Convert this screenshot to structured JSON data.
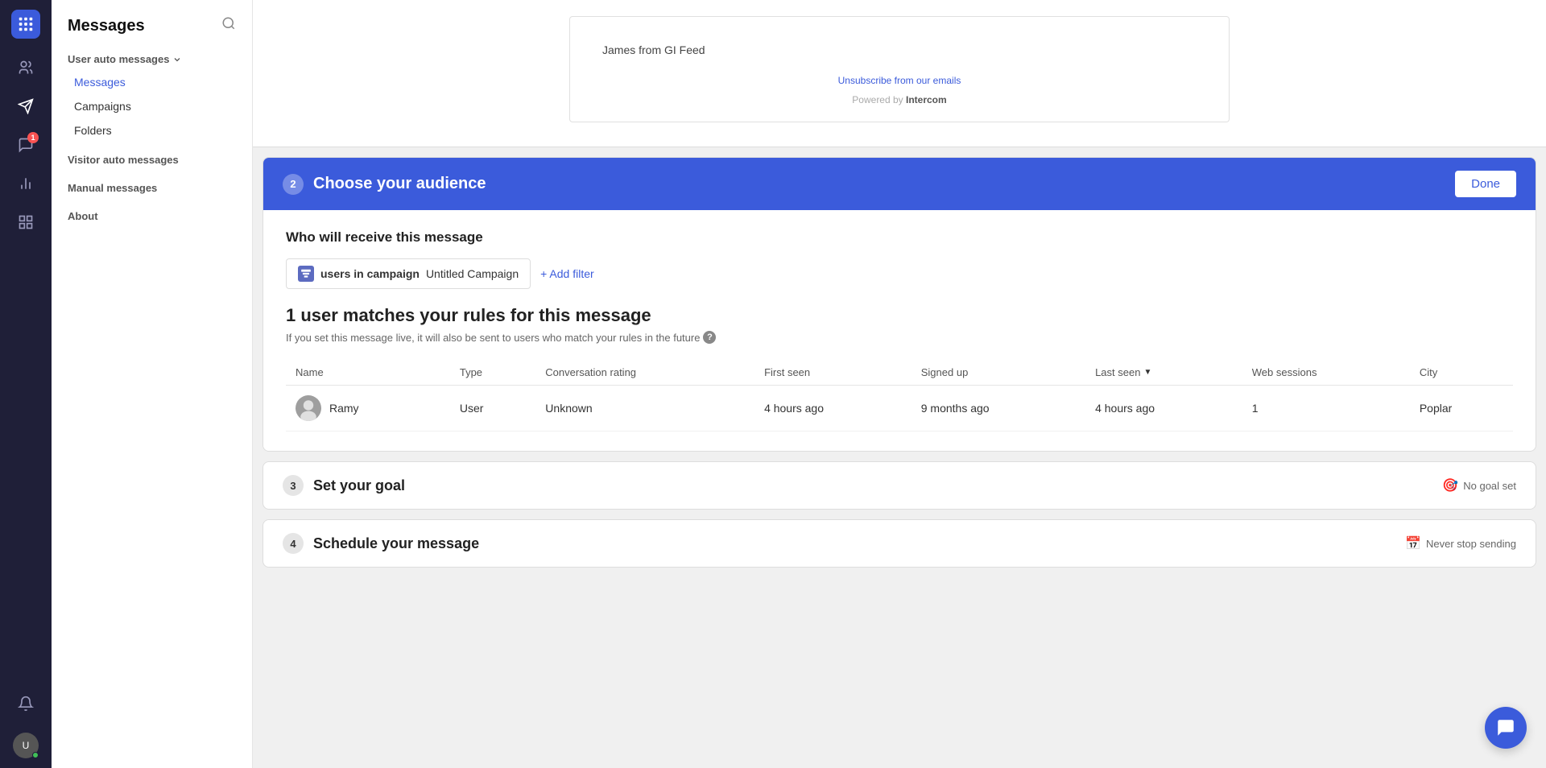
{
  "app": {
    "logo_alt": "Intercom"
  },
  "sidebar": {
    "icons": [
      {
        "name": "inbox-icon",
        "unicode": "💬",
        "active": false,
        "badge": null
      },
      {
        "name": "contacts-icon",
        "unicode": "👥",
        "active": false,
        "badge": null
      },
      {
        "name": "outbound-icon",
        "unicode": "✈",
        "active": true,
        "badge": null
      },
      {
        "name": "chat-icon",
        "unicode": "🗨",
        "active": false,
        "badge": "1"
      },
      {
        "name": "reports-icon",
        "unicode": "📊",
        "active": false,
        "badge": null
      },
      {
        "name": "apps-icon",
        "unicode": "⊞",
        "active": false,
        "badge": null
      },
      {
        "name": "notifications-icon",
        "unicode": "🔔",
        "active": false,
        "badge": null
      }
    ],
    "user_initials": "U",
    "online": true
  },
  "nav": {
    "title": "Messages",
    "sections": [
      {
        "label": "User auto messages",
        "dropdown": true,
        "items": [
          {
            "label": "Messages",
            "active": true
          },
          {
            "label": "Campaigns",
            "active": false
          },
          {
            "label": "Folders",
            "active": false
          }
        ]
      },
      {
        "label": "Visitor auto messages",
        "dropdown": false,
        "items": []
      },
      {
        "label": "Manual messages",
        "dropdown": false,
        "items": []
      },
      {
        "label": "About",
        "dropdown": false,
        "items": []
      }
    ]
  },
  "email_preview": {
    "sender": "James from GI Feed",
    "unsubscribe_text": "Unsubscribe from our emails",
    "powered_by_prefix": "Powered by ",
    "powered_by_brand": "Intercom"
  },
  "choose_audience": {
    "step_number": "2",
    "title": "Choose your audience",
    "done_label": "Done",
    "who_receives": "Who will receive this message",
    "filter": {
      "icon_label": "layers",
      "filter_bold": "users in campaign",
      "filter_value": "Untitled Campaign"
    },
    "add_filter_label": "+ Add filter",
    "match_headline": "1 user matches your rules for this message",
    "match_subtext": "If you set this message live, it will also be sent to users who match your rules in the future",
    "table": {
      "columns": [
        {
          "label": "Name",
          "sortable": false
        },
        {
          "label": "Type",
          "sortable": false
        },
        {
          "label": "Conversation rating",
          "sortable": false
        },
        {
          "label": "First seen",
          "sortable": false
        },
        {
          "label": "Signed up",
          "sortable": false
        },
        {
          "label": "Last seen",
          "sortable": true
        },
        {
          "label": "Web sessions",
          "sortable": false
        },
        {
          "label": "City",
          "sortable": false
        }
      ],
      "rows": [
        {
          "name": "Ramy",
          "type": "User",
          "conversation_rating": "Unknown",
          "first_seen": "4 hours ago",
          "signed_up": "9 months ago",
          "last_seen": "4 hours ago",
          "web_sessions": "1",
          "city": "Poplar"
        }
      ]
    }
  },
  "set_goal": {
    "step_number": "3",
    "title": "Set your goal",
    "status_icon": "🎯",
    "status": "No goal set"
  },
  "schedule": {
    "step_number": "4",
    "title": "Schedule your message",
    "status_icon": "📅",
    "status": "Never stop sending"
  },
  "chat_button": {
    "label": "Open chat"
  }
}
